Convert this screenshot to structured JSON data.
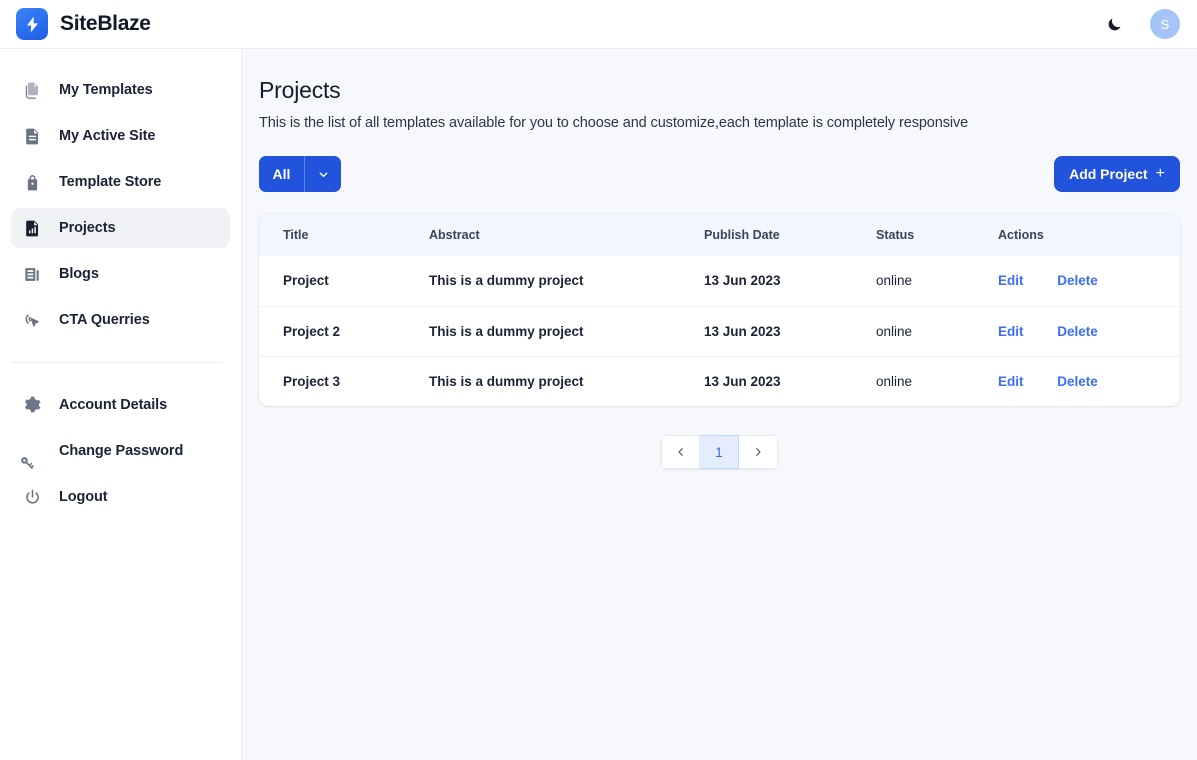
{
  "header": {
    "brand_name": "SiteBlaze",
    "logo_icon": "lightning-bolt-icon",
    "theme_toggle_icon": "moon-icon",
    "avatar_initial": "S",
    "accent_color": "#2253dd",
    "avatar_color": "#a6c4f7"
  },
  "sidebar": {
    "items": [
      {
        "label": "My Templates",
        "icon": "copy-documents-icon",
        "active": false
      },
      {
        "label": "My Active Site",
        "icon": "document-icon",
        "active": false
      },
      {
        "label": "Template Store",
        "icon": "store-bag-icon",
        "active": false
      },
      {
        "label": "Projects",
        "icon": "chart-document-icon",
        "active": true
      },
      {
        "label": "Blogs",
        "icon": "newspaper-icon",
        "active": false
      },
      {
        "label": "CTA Querries",
        "icon": "cursor-click-icon",
        "active": false
      }
    ],
    "footer_items": [
      {
        "label": "Account Details",
        "icon": "gear-icon",
        "active": false
      },
      {
        "label": "Change Password",
        "icon": "key-icon",
        "active": false
      },
      {
        "label": "Logout",
        "icon": "power-icon",
        "active": false
      }
    ]
  },
  "main": {
    "title": "Projects",
    "subtitle": "This is the list of all templates available for you to choose and customize,each template is completely responsive",
    "filter": {
      "label": "All",
      "caret_icon": "chevron-down-icon"
    },
    "add_button": {
      "label": "Add Project",
      "icon": "plus-icon"
    },
    "table": {
      "columns": [
        "Title",
        "Abstract",
        "Publish Date",
        "Status",
        "Actions"
      ],
      "rows": [
        {
          "title": "Project",
          "abstract": "This is a dummy project",
          "publish_date": "13 Jun 2023",
          "status": "online",
          "edit_label": "Edit",
          "delete_label": "Delete"
        },
        {
          "title": "Project 2",
          "abstract": "This is a dummy project",
          "publish_date": "13 Jun 2023",
          "status": "online",
          "edit_label": "Edit",
          "delete_label": "Delete"
        },
        {
          "title": "Project 3",
          "abstract": "This is a dummy project",
          "publish_date": "13 Jun 2023",
          "status": "online",
          "edit_label": "Edit",
          "delete_label": "Delete"
        }
      ]
    },
    "pagination": {
      "prev_icon": "chevron-left-icon",
      "next_icon": "chevron-right-icon",
      "current_page": "1"
    }
  }
}
